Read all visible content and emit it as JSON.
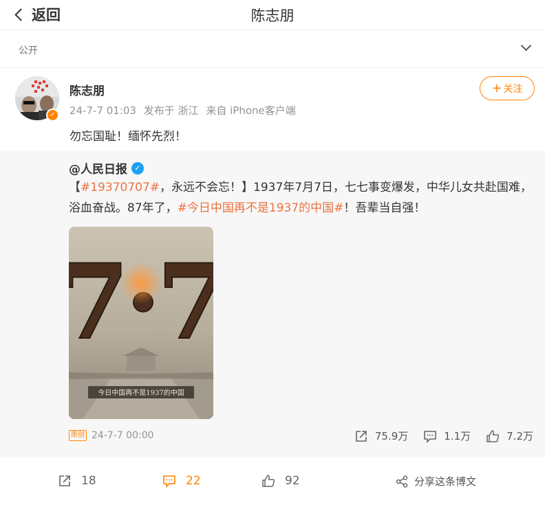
{
  "header": {
    "back_label": "返回",
    "title": "陈志朋"
  },
  "visibility": {
    "label": "公开"
  },
  "post": {
    "author": "陈志朋",
    "meta": {
      "time": "24-7-7 01:03",
      "location": "发布于 浙江",
      "source": "来自 iPhone客户端"
    },
    "follow_label": "关注",
    "text": "勿忘国耻！缅怀先烈！",
    "actions": {
      "repost_count": "18",
      "comment_count": "22",
      "like_count": "92",
      "share_label": "分享这条博文"
    }
  },
  "repost": {
    "author": "@人民日报",
    "text_parts": {
      "p1": "【",
      "tag1": "#19370707#",
      "p2": "，永远不会忘！】1937年7月7日，七七事变爆发，中华儿女共赴国难，浴血奋战。87年了，",
      "tag2": "#今日中国再不是1937的中国#",
      "p3": "！吾辈当自强！"
    },
    "image": {
      "big_text": "7·7",
      "caption": "今日中国再不是1937的中国"
    },
    "original_badge": "原创",
    "time": "24-7-7 00:00",
    "stats": {
      "reposts": "75.9万",
      "comments": "1.1万",
      "likes": "7.2万"
    }
  },
  "colors": {
    "accent": "#ff8200",
    "tag": "#eb7340",
    "verified": "#1da1f2"
  }
}
